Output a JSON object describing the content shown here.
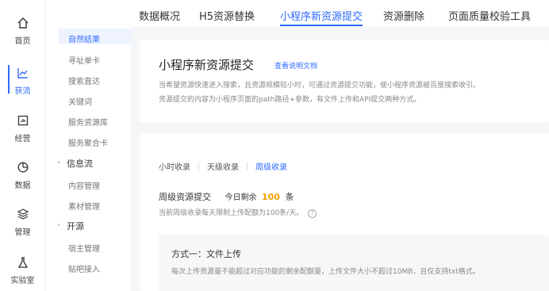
{
  "rail": {
    "items": [
      {
        "label": "首页",
        "icon": "home-icon"
      },
      {
        "label": "获流",
        "icon": "traffic-chart-icon"
      },
      {
        "label": "经营",
        "icon": "operation-icon"
      },
      {
        "label": "数据",
        "icon": "data-icon"
      },
      {
        "label": "管理",
        "icon": "manage-icon"
      },
      {
        "label": "实验室",
        "icon": "flask-icon"
      }
    ],
    "active_color": "#2f6bff"
  },
  "menu": {
    "items": [
      "自然结果",
      "寻址单卡",
      "搜索直达",
      "关键词",
      "服务资源库",
      "服务聚合卡"
    ],
    "group_feed": "信息流",
    "feed_items": [
      "内容管理",
      "素材管理"
    ],
    "group_open": "开源",
    "open_items": [
      "宿主管理",
      "贴吧接入"
    ]
  },
  "tabs": [
    "数据概况",
    "H5资源替换",
    "小程序新资源提交",
    "资源删除",
    "页面质量校验工具"
  ],
  "active_tab": "小程序新资源提交",
  "intro": {
    "title": "小程序新资源提交",
    "doc_link": "查看说明文档",
    "desc_line1": "当希望资源快速进入搜索，且资源规模较小时，可通过资源提交功能，使小程序资源被百度搜索收引。",
    "desc_line2": "资源提交的内容为小程序页面的path路径+参数，有文件上传和API提交两种方式。"
  },
  "submit": {
    "subtabs": [
      "小时收录",
      "天级收录",
      "周级收录"
    ],
    "active_subtab": "周级收录",
    "quota_title": "周级资源提交",
    "remain_prefix": "今日剩余",
    "remain_count": "100",
    "remain_unit": "条",
    "limit_text": "当前周级收录每天限制上传配额为100条/天。",
    "help_glyph": "?",
    "method_title": "方式一：文件上传",
    "method_desc": "每次上传资源量不能超过对应功能的剩余配额量，上传文件大小不超过10MB，且仅支持txt格式。"
  }
}
